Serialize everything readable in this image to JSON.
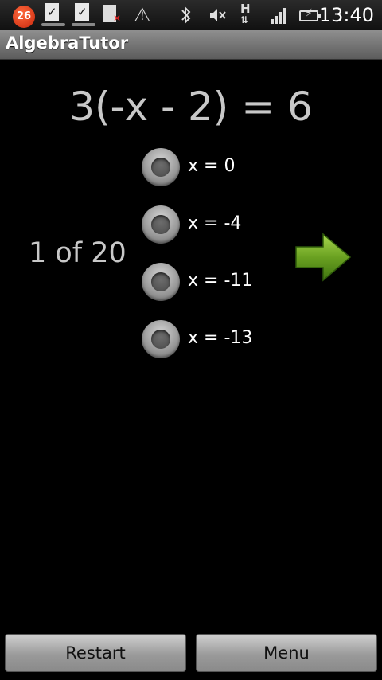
{
  "status_bar": {
    "notification_count": "26",
    "time": "13:40",
    "icons": [
      "notification-badge-icon",
      "task-done-icon",
      "task-done-icon",
      "sd-card-removed-icon",
      "warning-icon",
      "bluetooth-icon",
      "volume-muted-icon",
      "data-transfer-icon",
      "signal-icon",
      "battery-charging-icon"
    ]
  },
  "app": {
    "title": "AlgebraTutor"
  },
  "question": {
    "equation": "3(-x - 2) = 6",
    "progress": "1 of 20",
    "options": [
      {
        "label": "x = 0"
      },
      {
        "label": "x = -4"
      },
      {
        "label": "x = -11"
      },
      {
        "label": "x = -13"
      }
    ]
  },
  "buttons": {
    "restart": "Restart",
    "menu": "Menu"
  },
  "colors": {
    "arrow": "#6aa121",
    "background": "#000000",
    "equation_text": "#c8c8c8"
  }
}
